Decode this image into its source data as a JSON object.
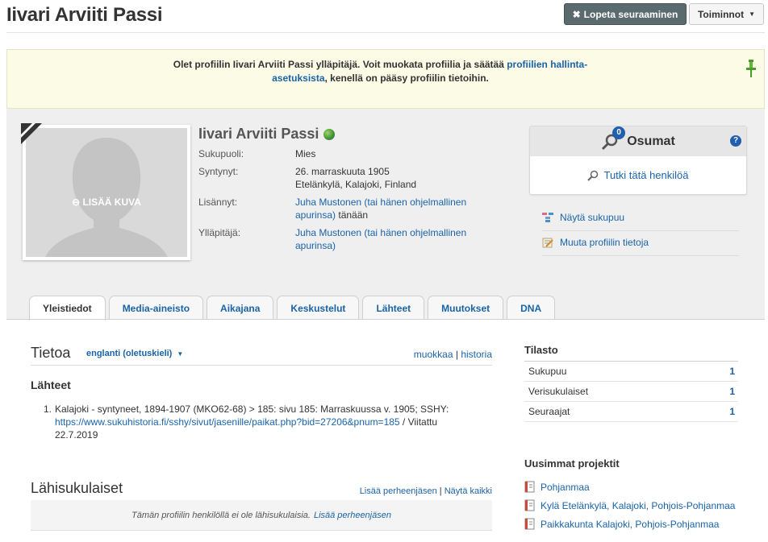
{
  "header": {
    "title": "Iivari Arviiti Passi",
    "unfollow_label": "Lopeta seuraaminen",
    "actions_label": "Toiminnot"
  },
  "notice": {
    "text_before": "Olet profiilin Iivari Arviiti Passi ylläpitäjä. Voit muokata profiilia ja säätää ",
    "link": "profiilien hallinta-asetuksista",
    "text_after": ", kenellä on pääsy profiilin tietoihin."
  },
  "profile": {
    "name": "Iivari Arviiti Passi",
    "add_photo_label": "LISÄÄ KUVA",
    "facts": [
      {
        "label": "Sukupuoli:",
        "value": "Mies"
      },
      {
        "label": "Syntynyt:",
        "value": "26. marraskuuta 1905",
        "value2": "Etelänkylä, Kalajoki, Finland"
      },
      {
        "label": "Lisännyt:",
        "link": "Juha Mustonen (tai hänen ohjelmallinen apurinsa)",
        "suffix": " tänään"
      },
      {
        "label": "Ylläpitäjä:",
        "link": "Juha Mustonen (tai hänen ohjelmallinen apurinsa)"
      }
    ]
  },
  "matches": {
    "count": "0",
    "title": "Osumat",
    "help": "?",
    "research_label": "Tutki tätä henkilöä"
  },
  "side_links": {
    "tree": "Näytä sukupuu",
    "edit": "Muuta profiilin tietoja"
  },
  "tabs": [
    "Yleistiedot",
    "Media-aineisto",
    "Aikajana",
    "Keskustelut",
    "Lähteet",
    "Muutokset",
    "DNA"
  ],
  "about": {
    "title": "Tietoa",
    "language": "englanti (oletuskieli)",
    "edit": "muokkaa",
    "separator": "|",
    "history": "historia"
  },
  "sources": {
    "title": "Lähteet",
    "items": [
      {
        "num": "1.",
        "text": "Kalajoki - syntyneet, 1894-1907 (MKO62-68) > 185: sivu 185: Marraskuussa v. 1905; SSHY:",
        "url": "https://www.sukuhistoria.fi/sshy/sivut/jasenille/paikat.php?bid=27206&pnum=185",
        "after": " / Viitattu 22.7.2019"
      }
    ]
  },
  "relatives": {
    "title": "Lähisukulaiset",
    "add": "Lisää perheenjäsen",
    "separator": "|",
    "show_all": "Näytä kaikki",
    "empty_text": "Tämän profiilin henkilöllä ei ole lähisukulaisia.",
    "empty_link": "Lisää perheenjäsen"
  },
  "stats": {
    "title": "Tilasto",
    "rows": [
      {
        "label": "Sukupuu",
        "value": "1"
      },
      {
        "label": "Verisukulaiset",
        "value": "1"
      },
      {
        "label": "Seuraajat",
        "value": "1"
      }
    ]
  },
  "projects": {
    "title": "Uusimmat projektit",
    "items": [
      "Pohjanmaa",
      "Kylä Etelänkylä, Kalajoki, Pohjois-Pohjanmaa",
      "Paikkakunta Kalajoki, Pohjois-Pohjanmaa"
    ]
  },
  "colors": {
    "link": "#1a63a8",
    "unfollow_bg": "#5a6a6e",
    "notice_bg": "#fbfbe6",
    "profile_bg": "#efefef"
  }
}
